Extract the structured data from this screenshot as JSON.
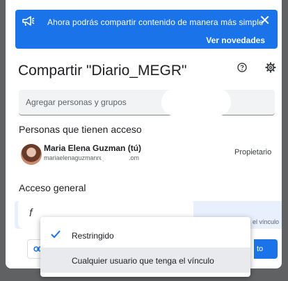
{
  "banner": {
    "message": "Ahora podrás compartir contenido de manera más simple",
    "action_label": "Ver novedades",
    "close_glyph": "✕",
    "icon": "megaphone-icon"
  },
  "dialog": {
    "title": "Compartir \"Diario_MEGR\"",
    "help_icon": "help-circle-icon",
    "settings_icon": "gear-icon"
  },
  "add_people": {
    "placeholder": "Agregar personas y grupos"
  },
  "people_section": {
    "heading": "Personas que tienen acceso",
    "users": [
      {
        "name": "Maria Elena Guzman (tú)",
        "email": "mariaelenaguzmanreyes       mail.com",
        "role": "Propietario"
      }
    ]
  },
  "general_access": {
    "heading": "Acceso general",
    "current_initial": "f",
    "hint_fragment": "el vínculo"
  },
  "footer": {
    "copy_link_icon": "link-icon",
    "done_label": "to"
  },
  "dropdown": {
    "options": [
      {
        "label": "Restringido",
        "selected": true
      },
      {
        "label": "Cualquier usuario que tenga el vínculo",
        "selected": false
      }
    ]
  },
  "colors": {
    "accent": "#1a73e8",
    "backdrop": "#5f6163",
    "highlight": "#e8eaed"
  }
}
